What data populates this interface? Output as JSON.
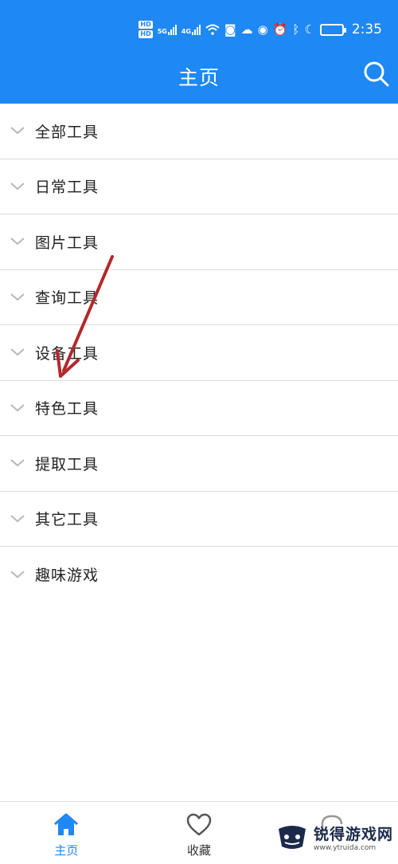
{
  "status_bar": {
    "hd1": "HD",
    "hd2": "HD",
    "net1": "5G",
    "net2": "4G",
    "battery": "",
    "time": "2:35"
  },
  "header": {
    "title": "主页",
    "search_icon": "search-icon"
  },
  "tool_list": {
    "items": [
      {
        "label": "全部工具"
      },
      {
        "label": "日常工具"
      },
      {
        "label": "图片工具"
      },
      {
        "label": "查询工具"
      },
      {
        "label": "设备工具"
      },
      {
        "label": "特色工具"
      },
      {
        "label": "提取工具"
      },
      {
        "label": "其它工具"
      },
      {
        "label": "趣味游戏"
      }
    ]
  },
  "bottom_nav": {
    "items": [
      {
        "label": "主页",
        "icon": "home-icon",
        "active": true
      },
      {
        "label": "收藏",
        "icon": "heart-icon",
        "active": false
      },
      {
        "label": "",
        "icon": "partial-icon",
        "active": false
      }
    ]
  },
  "watermark": {
    "name": "锐得游戏网",
    "url": "www.ytruida.com"
  },
  "colors": {
    "primary": "#1e88f5",
    "divider": "#dcdcdc",
    "arrow": "#b3282b"
  }
}
